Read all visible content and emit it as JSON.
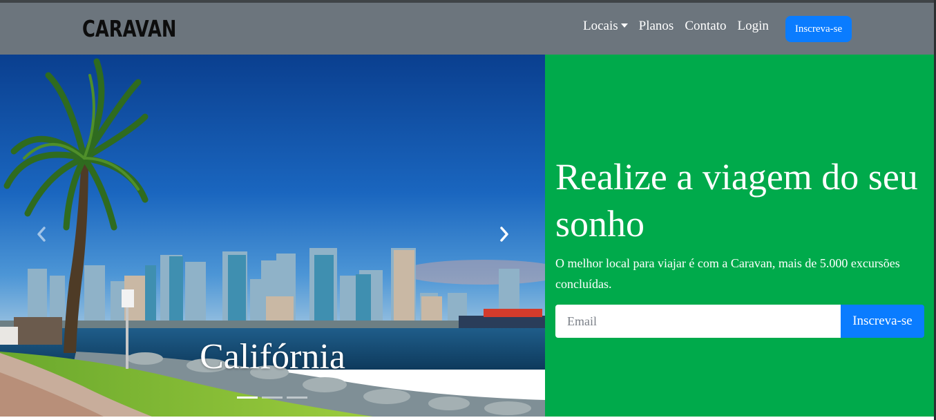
{
  "navbar": {
    "brand": "CARAVAN",
    "links": [
      "Locais",
      "Planos",
      "Contato",
      "Login"
    ],
    "signup_label": "Inscreva-se"
  },
  "carousel": {
    "caption": "Califórnia",
    "indicator_count": 3,
    "active_index": 0
  },
  "cta": {
    "title": "Realize a viagem do seu sonho",
    "text": "O melhor local para viajar é com a Caravan, mais de 5.000 excursões concluídas.",
    "email_placeholder": "Email",
    "button_label": "Inscreva-se"
  },
  "colors": {
    "navbar_bg": "#6c757d",
    "cta_bg": "#00aa4b",
    "primary_button": "#0a7cff"
  },
  "icons": {
    "dropdown": "caret-down-icon",
    "prev": "chevron-left-icon",
    "next": "chevron-right-icon"
  }
}
